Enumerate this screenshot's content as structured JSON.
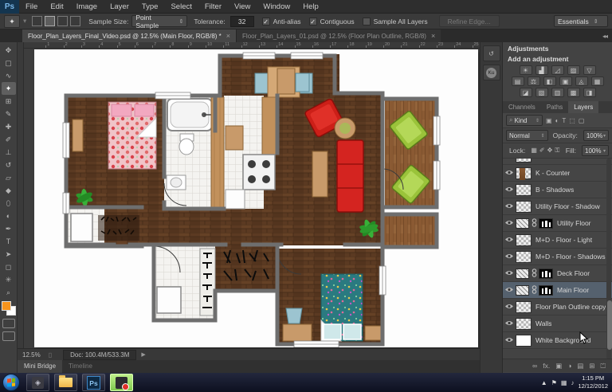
{
  "app": {
    "logo": "Ps"
  },
  "menu": {
    "items": [
      "File",
      "Edit",
      "Image",
      "Layer",
      "Type",
      "Select",
      "Filter",
      "View",
      "Window",
      "Help"
    ]
  },
  "options": {
    "sample_size_label": "Sample Size:",
    "sample_size_value": "Point Sample",
    "tolerance_label": "Tolerance:",
    "tolerance_value": "32",
    "checkboxes": [
      {
        "label": "Anti-alias",
        "checked": true
      },
      {
        "label": "Contiguous",
        "checked": true
      },
      {
        "label": "Sample All Layers",
        "checked": false
      }
    ],
    "refine_edge_label": "Refine Edge...",
    "workspace": "Essentials"
  },
  "document_tabs": [
    {
      "title": "Floor_Plan_Layers_Final_Video.psd @ 12.5% (Main Floor, RGB/8) *",
      "close": "×",
      "active": true
    },
    {
      "title": "Floor_Plan_Layers_01.psd @ 12.5% (Floor Plan Outline, RGB/8)",
      "close": "×",
      "active": false
    }
  ],
  "tools": [
    {
      "name": "move-tool",
      "glyph": "✥",
      "active": false
    },
    {
      "name": "marquee-tool",
      "glyph": "▢",
      "active": false
    },
    {
      "name": "lasso-tool",
      "glyph": "∿",
      "active": false
    },
    {
      "name": "magic-wand-tool",
      "glyph": "✦",
      "active": true
    },
    {
      "name": "crop-tool",
      "glyph": "⊞",
      "active": false
    },
    {
      "name": "eyedropper-tool",
      "glyph": "✎",
      "active": false
    },
    {
      "name": "healing-brush-tool",
      "glyph": "✚",
      "active": false
    },
    {
      "name": "brush-tool",
      "glyph": "✐",
      "active": false
    },
    {
      "name": "clone-stamp-tool",
      "glyph": "⊥",
      "active": false
    },
    {
      "name": "history-brush-tool",
      "glyph": "↺",
      "active": false
    },
    {
      "name": "eraser-tool",
      "glyph": "▱",
      "active": false
    },
    {
      "name": "gradient-tool",
      "glyph": "◆",
      "active": false
    },
    {
      "name": "blur-tool",
      "glyph": "⬯",
      "active": false
    },
    {
      "name": "dodge-tool",
      "glyph": "◐",
      "active": false
    },
    {
      "name": "pen-tool",
      "glyph": "✒",
      "active": false
    },
    {
      "name": "type-tool",
      "glyph": "T",
      "active": false
    },
    {
      "name": "path-select-tool",
      "glyph": "➤",
      "active": false
    },
    {
      "name": "shape-tool",
      "glyph": "◻",
      "active": false
    },
    {
      "name": "hand-tool",
      "glyph": "✳",
      "active": false
    },
    {
      "name": "zoom-tool",
      "glyph": "⌕",
      "active": false
    }
  ],
  "swatches": {
    "foreground": "#f7941d",
    "background": "#ffffff"
  },
  "ruler": {
    "max": 25
  },
  "status": {
    "zoom": "12.5%",
    "doc": "Doc: 100.4M/533.3M",
    "arrow": "▶"
  },
  "bottom_tabs": [
    {
      "label": "Mini Bridge",
      "active": true
    },
    {
      "label": "Timeline",
      "active": false
    }
  ],
  "dock_strip": [
    {
      "name": "history-panel-icon",
      "glyph": "↺"
    },
    {
      "name": "kuler-panel-icon",
      "glyph": "Ku"
    }
  ],
  "adjustments": {
    "title": "Adjustments",
    "subtitle": "Add an adjustment",
    "rows": [
      [
        {
          "name": "brightness-contrast-icon",
          "glyph": "☀"
        },
        {
          "name": "levels-icon",
          "glyph": "▟"
        },
        {
          "name": "curves-icon",
          "glyph": "◿"
        },
        {
          "name": "exposure-icon",
          "glyph": "▨"
        },
        {
          "name": "vibrance-icon",
          "glyph": "▽"
        }
      ],
      [
        {
          "name": "hue-saturation-icon",
          "glyph": "▤"
        },
        {
          "name": "color-balance-icon",
          "glyph": "⚖"
        },
        {
          "name": "black-white-icon",
          "glyph": "◧"
        },
        {
          "name": "photo-filter-icon",
          "glyph": "▣"
        },
        {
          "name": "channel-mixer-icon",
          "glyph": "◬"
        },
        {
          "name": "color-lookup-icon",
          "glyph": "▦"
        }
      ],
      [
        {
          "name": "invert-icon",
          "glyph": "◪"
        },
        {
          "name": "posterize-icon",
          "glyph": "▧"
        },
        {
          "name": "threshold-icon",
          "glyph": "▥"
        },
        {
          "name": "selective-color-icon",
          "glyph": "▩"
        },
        {
          "name": "gradient-map-icon",
          "glyph": "◨"
        }
      ]
    ]
  },
  "layers_panel": {
    "tabs": [
      {
        "label": "Channels",
        "active": false
      },
      {
        "label": "Paths",
        "active": false
      },
      {
        "label": "Layers",
        "active": true
      }
    ],
    "search_glyph": "⌕",
    "kind": "Kind",
    "filter_icons": [
      {
        "name": "pixel-layer-filter-icon",
        "glyph": "▣"
      },
      {
        "name": "adjustment-layer-filter-icon",
        "glyph": "◐"
      },
      {
        "name": "type-layer-filter-icon",
        "glyph": "T"
      },
      {
        "name": "shape-layer-filter-icon",
        "glyph": "⬚"
      },
      {
        "name": "smart-object-filter-icon",
        "glyph": "▢"
      }
    ],
    "blend_mode": "Normal",
    "opacity_label": "Opacity:",
    "opacity_value": "100%",
    "lock_label": "Lock:",
    "lock_icons": [
      {
        "name": "lock-transparency-icon",
        "glyph": "▦"
      },
      {
        "name": "lock-pixels-icon",
        "glyph": "✐"
      },
      {
        "name": "lock-position-icon",
        "glyph": "✥"
      },
      {
        "name": "lock-all-icon",
        "glyph": "⚿"
      }
    ],
    "fill_label": "Fill:",
    "fill_value": "100%",
    "layers": [
      {
        "name": "",
        "thumb": "checker",
        "mask": false,
        "selected": false,
        "partial": true
      },
      {
        "name": "K - Counter",
        "thumb": "counter",
        "mask": false,
        "selected": false
      },
      {
        "name": "B - Shadows",
        "thumb": "checker",
        "mask": false,
        "selected": false
      },
      {
        "name": "Utility Floor - Shadow",
        "thumb": "checker",
        "mask": false,
        "selected": false
      },
      {
        "name": "Utility Floor",
        "thumb": "hatch",
        "mask": true,
        "selected": false
      },
      {
        "name": "M+D - Floor - Light",
        "thumb": "checker",
        "mask": false,
        "selected": false
      },
      {
        "name": "M+D - Floor - Shadows",
        "thumb": "checker",
        "mask": false,
        "selected": false
      },
      {
        "name": "Deck Floor",
        "thumb": "hatch",
        "mask": true,
        "selected": false
      },
      {
        "name": "Main Floor",
        "thumb": "hatch",
        "mask": true,
        "selected": true
      },
      {
        "name": "Floor Plan Outline copy",
        "thumb": "checker",
        "mask": false,
        "selected": false
      },
      {
        "name": "Walls",
        "thumb": "checker",
        "mask": false,
        "selected": false
      },
      {
        "name": "White Background",
        "thumb": "white",
        "mask": false,
        "selected": false
      }
    ],
    "footer_icons": [
      {
        "name": "link-layers-icon",
        "glyph": "∞"
      },
      {
        "name": "layer-style-icon",
        "glyph": "fx."
      },
      {
        "name": "add-layer-mask-icon",
        "glyph": "▣"
      },
      {
        "name": "new-adjustment-layer-icon",
        "glyph": "◑"
      },
      {
        "name": "new-group-icon",
        "glyph": "▤"
      },
      {
        "name": "new-layer-icon",
        "glyph": "⊞"
      },
      {
        "name": "delete-layer-icon",
        "glyph": "⏍"
      }
    ]
  },
  "taskbar": {
    "apps": [
      {
        "name": "taskbar-viewer-app",
        "kind": "viewer",
        "hot": false
      },
      {
        "name": "taskbar-explorer-app",
        "kind": "folder",
        "hot": false
      },
      {
        "name": "taskbar-photoshop-app",
        "kind": "ps",
        "label": "Ps",
        "hot": false
      },
      {
        "name": "taskbar-recorder-app",
        "kind": "rec",
        "hot": true
      }
    ],
    "tray_icons": [
      {
        "name": "tray-show-hidden-icon",
        "glyph": "▲"
      },
      {
        "name": "tray-action-center-icon",
        "glyph": "⚑"
      },
      {
        "name": "tray-network-icon",
        "glyph": "▦"
      },
      {
        "name": "tray-volume-icon",
        "glyph": "♪"
      }
    ],
    "time": "1:15 PM",
    "date": "12/12/2012"
  }
}
